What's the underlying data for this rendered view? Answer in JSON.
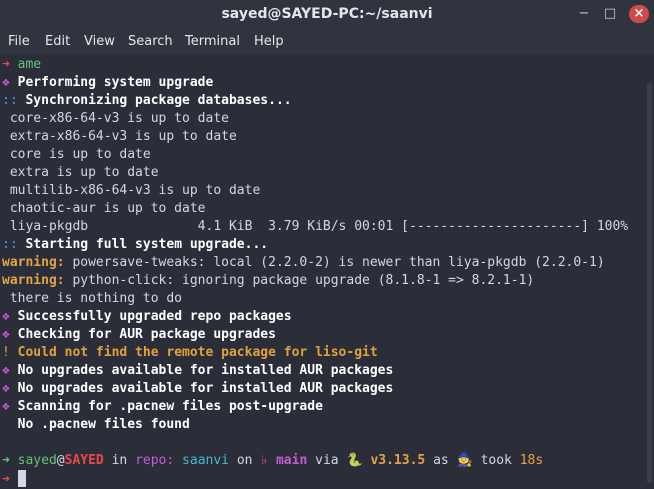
{
  "window": {
    "title": "sayed@SAYED-PC:~/saanvi",
    "min_glyph": "−",
    "max_glyph": "□",
    "close_glyph": "×"
  },
  "menu": [
    "File",
    "Edit",
    "View",
    "Search",
    "Terminal",
    "Help"
  ],
  "colors": {
    "red": "#ea4949",
    "green": "#67c17a",
    "magenta": "#c85ad3",
    "blue": "#5294e2",
    "cyan": "#48b9c7",
    "yellow": "#e5a445",
    "orange": "#e2a23b",
    "text": "#d3d7df",
    "bold_white": "#ffffff"
  },
  "lines": [
    [
      {
        "t": "➜ ",
        "c": "red"
      },
      {
        "t": "ame",
        "c": "green"
      }
    ],
    [
      {
        "t": "❖ ",
        "c": "magenta"
      },
      {
        "t": "Performing system upgrade",
        "c": "bold_white",
        "b": true
      }
    ],
    [
      {
        "t": ":: ",
        "c": "blue"
      },
      {
        "t": "Synchronizing package databases...",
        "c": "bold_white",
        "b": true
      }
    ],
    [
      {
        "t": " core-x86-64-v3 is up to date",
        "c": "text"
      }
    ],
    [
      {
        "t": " extra-x86-64-v3 is up to date",
        "c": "text"
      }
    ],
    [
      {
        "t": " core is up to date",
        "c": "text"
      }
    ],
    [
      {
        "t": " extra is up to date",
        "c": "text"
      }
    ],
    [
      {
        "t": " multilib-x86-64-v3 is up to date",
        "c": "text"
      }
    ],
    [
      {
        "t": " chaotic-aur is up to date",
        "c": "text"
      }
    ],
    [
      {
        "t": " liya-pkgdb              4.1 KiB  3.79 KiB/s 00:01 [----------------------] 100%",
        "c": "text"
      }
    ],
    [
      {
        "t": ":: ",
        "c": "blue"
      },
      {
        "t": "Starting full system upgrade...",
        "c": "bold_white",
        "b": true
      }
    ],
    [
      {
        "t": "warning:",
        "c": "yellow",
        "b": true
      },
      {
        "t": " powersave-tweaks: local (2.2.0-2) is newer than liya-pkgdb (2.2.0-1)",
        "c": "text"
      }
    ],
    [
      {
        "t": "warning:",
        "c": "yellow",
        "b": true
      },
      {
        "t": " python-click: ignoring package upgrade (8.1.8-1 => 8.2.1-1)",
        "c": "text"
      }
    ],
    [
      {
        "t": " there is nothing to do",
        "c": "text"
      }
    ],
    [
      {
        "t": "❖ ",
        "c": "magenta"
      },
      {
        "t": "Successfully upgraded repo packages",
        "c": "bold_white",
        "b": true
      }
    ],
    [
      {
        "t": "❖ ",
        "c": "magenta"
      },
      {
        "t": "Checking for AUR package upgrades",
        "c": "bold_white",
        "b": true
      }
    ],
    [
      {
        "t": "! ",
        "c": "orange"
      },
      {
        "t": "Could not find the remote package for liso-git",
        "c": "orange",
        "b": true
      }
    ],
    [
      {
        "t": "❖ ",
        "c": "magenta"
      },
      {
        "t": "No upgrades available for installed AUR packages",
        "c": "bold_white",
        "b": true
      }
    ],
    [
      {
        "t": "❖ ",
        "c": "magenta"
      },
      {
        "t": "No upgrades available for installed AUR packages",
        "c": "bold_white",
        "b": true
      }
    ],
    [
      {
        "t": "❖ ",
        "c": "magenta"
      },
      {
        "t": "Scanning for .pacnew files post-upgrade",
        "c": "bold_white",
        "b": true
      }
    ],
    [
      {
        "t": "  No .pacnew files found",
        "c": "bold_white",
        "b": true
      }
    ],
    [
      {
        "t": "",
        "c": "text"
      }
    ],
    [
      {
        "t": "➜ ",
        "c": "green"
      },
      {
        "t": "sayed",
        "c": "green"
      },
      {
        "t": "@",
        "c": "text"
      },
      {
        "t": "SAYED",
        "c": "red",
        "b": true
      },
      {
        "t": " in ",
        "c": "text"
      },
      {
        "t": "repo:",
        "c": "magenta"
      },
      {
        "t": " saanvi ",
        "c": "cyan"
      },
      {
        "t": "on ",
        "c": "text"
      },
      {
        "t": "♭ ",
        "c": "magenta"
      },
      {
        "t": "main",
        "c": "magenta",
        "b": true
      },
      {
        "t": " via ",
        "c": "text"
      },
      {
        "t": "🐍 ",
        "c": "yellow"
      },
      {
        "t": "v3.13.5",
        "c": "yellow",
        "b": true
      },
      {
        "t": " as ",
        "c": "text"
      },
      {
        "t": "🧙 ",
        "c": "text"
      },
      {
        "t": "took ",
        "c": "text"
      },
      {
        "t": "18s",
        "c": "yellow"
      }
    ],
    [
      {
        "t": "➜ ",
        "c": "red"
      }
    ]
  ]
}
